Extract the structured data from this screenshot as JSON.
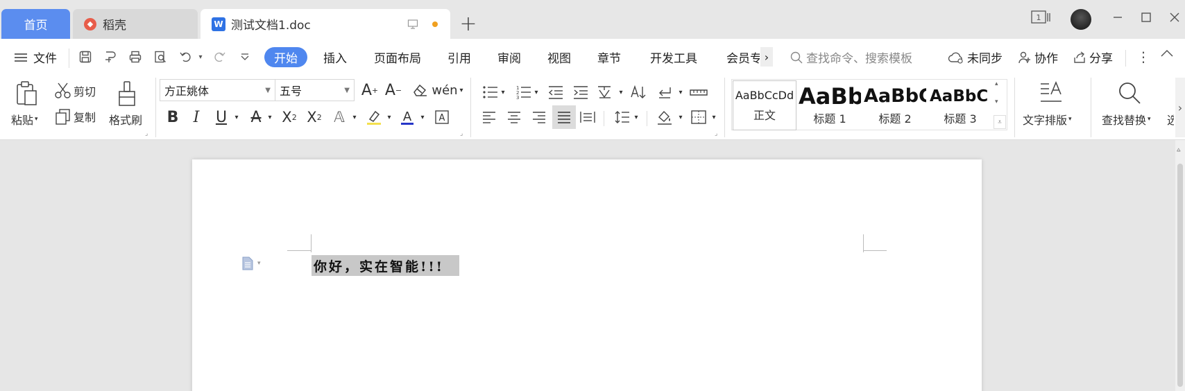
{
  "tabs": {
    "home": "首页",
    "daoke": "稻壳",
    "doc": "测试文档1.doc"
  },
  "window": {
    "layout_badge": "1"
  },
  "menu": {
    "file": "文件",
    "items": [
      "开始",
      "插入",
      "页面布局",
      "引用",
      "审阅",
      "视图",
      "章节",
      "开发工具",
      "会员专"
    ],
    "active": "开始",
    "search_placeholder": "查找命令、搜索模板",
    "sync": "未同步",
    "collab": "协作",
    "share": "分享"
  },
  "ribbon": {
    "paste": "粘贴",
    "cut": "剪切",
    "copy": "复制",
    "format_painter": "格式刷",
    "font_name": "方正姚体",
    "font_size": "五号",
    "styles": [
      {
        "sample": "AaBbCcDd",
        "name": "正文"
      },
      {
        "sample": "AaBb",
        "name": "标题 1"
      },
      {
        "sample": "AaBbC",
        "name": "标题 2"
      },
      {
        "sample": "AaBbC",
        "name": "标题 3"
      }
    ],
    "text_layout": "文字排版",
    "find_replace": "查找替换"
  },
  "document": {
    "text": "你好，实在智能!!!"
  }
}
